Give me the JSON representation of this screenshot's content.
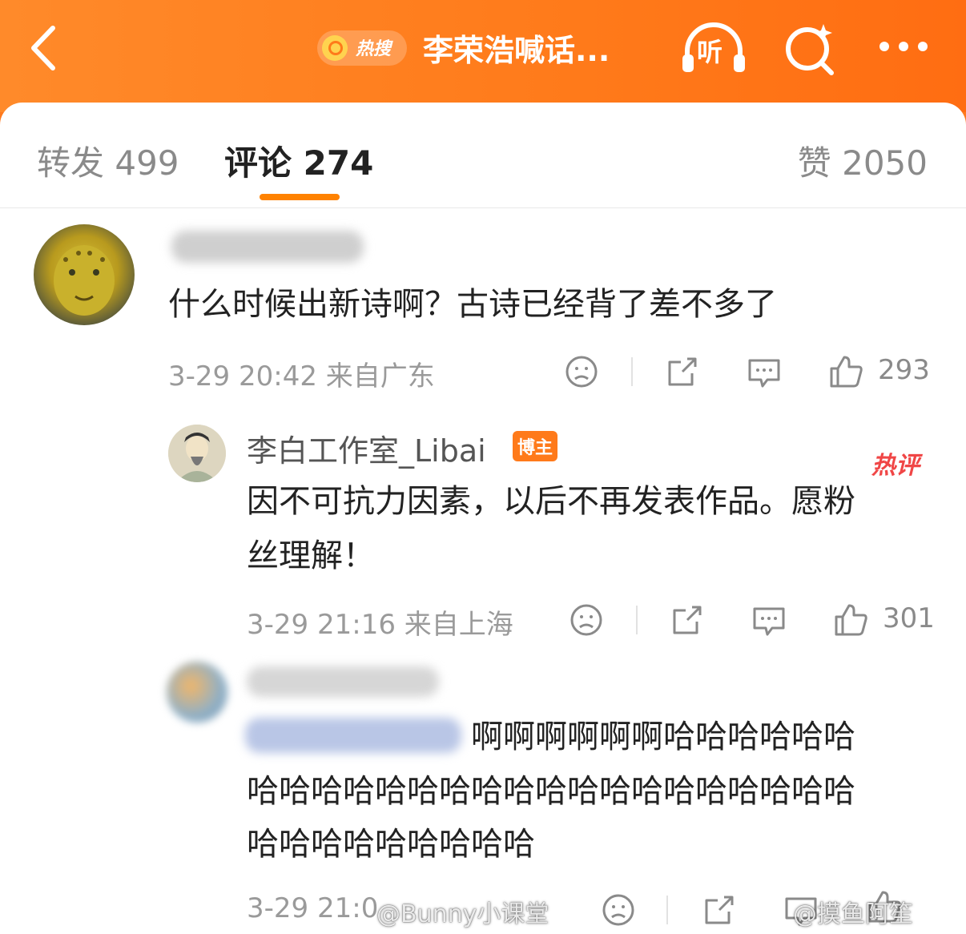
{
  "header": {
    "hot_badge": "热搜",
    "title": "李荣浩喊话...",
    "listen_label": "听",
    "accent": "#ff7a1a"
  },
  "tabs": {
    "repost": "转发 499",
    "comment": "评论 274",
    "like": "赞 2050"
  },
  "comments": [
    {
      "text": "什么时候出新诗啊？古诗已经背了差不多了",
      "meta": "3-29 20:42 来自广东",
      "likes": "293"
    },
    {
      "username": "李白工作室_Libai",
      "badge": "博主",
      "hot_tag": "热评",
      "text_line1": "因不可抗力因素，以后不再发表作品。愿粉",
      "text_line2": "丝理解！",
      "meta": "3-29 21:16 来自上海",
      "likes": "301"
    },
    {
      "text_line1": "啊啊啊啊啊啊哈哈哈哈哈哈",
      "text_line2": "哈哈哈哈哈哈哈哈哈哈哈哈哈哈哈哈哈哈哈",
      "text_line3": "哈哈哈哈哈哈哈哈哈",
      "meta_visible": "3-29 21:0"
    }
  ],
  "watermarks": {
    "left": "@Bunny小课堂",
    "right": "@摸鱼阿笙"
  },
  "icons": [
    "back-arrow-icon",
    "search-icon",
    "headphones-icon",
    "more-dots-icon",
    "dislike-face-icon",
    "share-icon",
    "comment-bubble-icon",
    "thumbs-up-icon"
  ]
}
